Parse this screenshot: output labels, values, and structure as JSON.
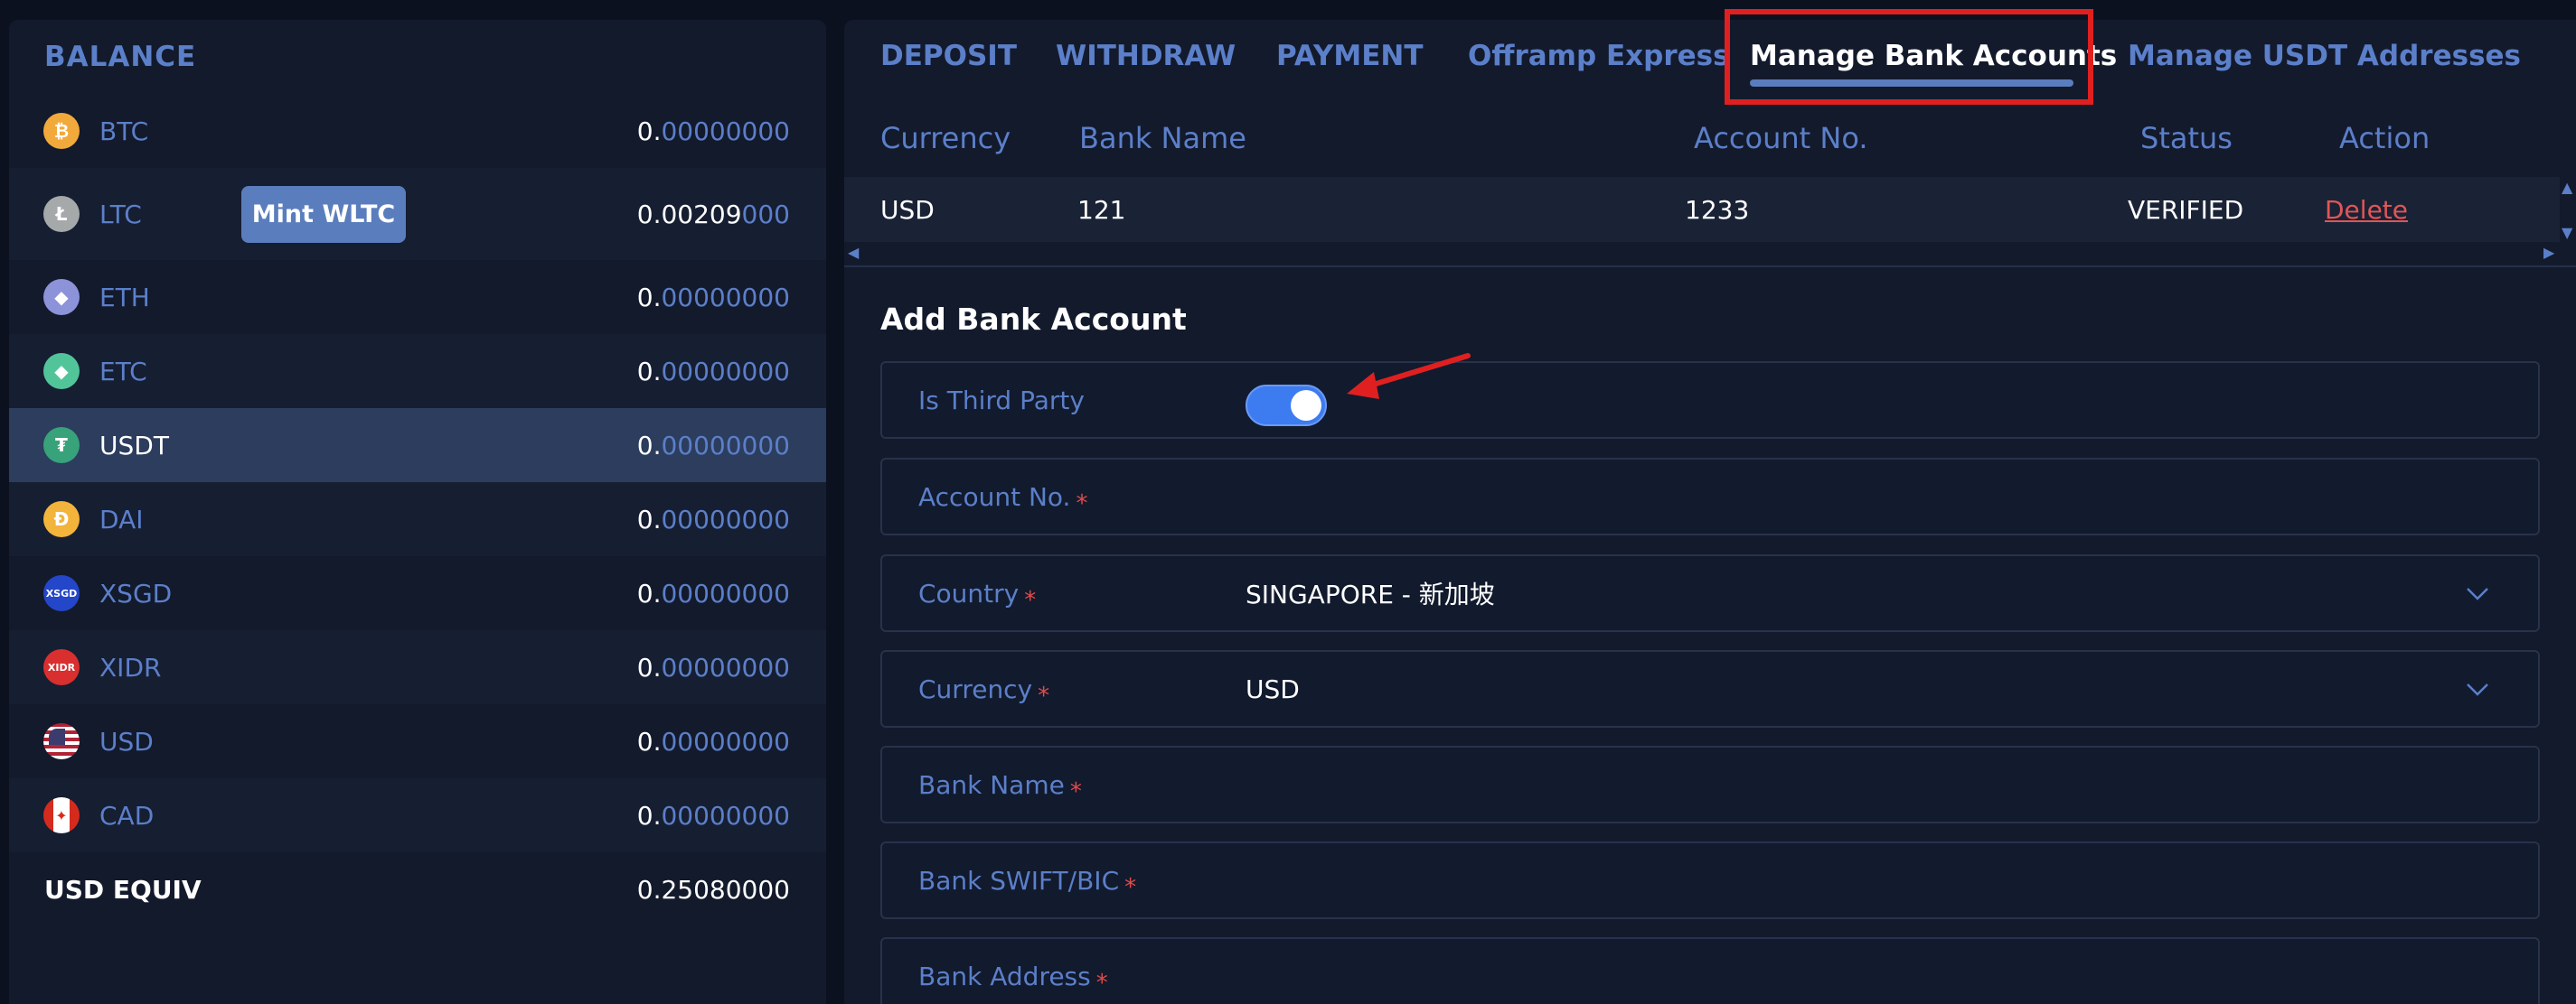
{
  "balance": {
    "title": "BALANCE",
    "assets": [
      {
        "symbol": "BTC",
        "whole": "0.",
        "dec": "00000000",
        "icon": "bitcoin-icon",
        "glyph": "₿",
        "color": "#f2a93b"
      },
      {
        "symbol": "LTC",
        "whole": "0.00209",
        "dec": "000",
        "icon": "litecoin-icon",
        "glyph": "Ł",
        "color": "#a6a9aa",
        "mint_label": "Mint WLTC"
      },
      {
        "symbol": "ETH",
        "whole": "0.",
        "dec": "00000000",
        "icon": "ethereum-icon",
        "glyph": "◆",
        "color": "#8c93d9"
      },
      {
        "symbol": "ETC",
        "whole": "0.",
        "dec": "00000000",
        "icon": "ethereum-classic-icon",
        "glyph": "◆",
        "color": "#52c49a"
      },
      {
        "symbol": "USDT",
        "whole": "0.",
        "dec": "00000000",
        "icon": "tether-icon",
        "glyph": "₮",
        "color": "#38a27a"
      },
      {
        "symbol": "DAI",
        "whole": "0.",
        "dec": "00000000",
        "icon": "dai-icon",
        "glyph": "Ð",
        "color": "#f2b43b"
      },
      {
        "symbol": "XSGD",
        "whole": "0.",
        "dec": "00000000",
        "icon": "xsgd-icon",
        "glyph": "XSGD",
        "color": "#2446c9"
      },
      {
        "symbol": "XIDR",
        "whole": "0.",
        "dec": "00000000",
        "icon": "xidr-icon",
        "glyph": "XIDR",
        "color": "#d92f2f"
      },
      {
        "symbol": "USD",
        "whole": "0.",
        "dec": "00000000",
        "icon": "us-flag-icon",
        "glyph": "",
        "color": "#b22234"
      },
      {
        "symbol": "CAD",
        "whole": "0.",
        "dec": "00000000",
        "icon": "canada-flag-icon",
        "glyph": "",
        "color": "#d52b1e"
      }
    ],
    "equiv_label": "USD EQUIV",
    "equiv_value": "0.25080000"
  },
  "tabs": [
    "DEPOSIT",
    "WITHDRAW",
    "PAYMENT",
    "Offramp Express",
    "Manage Bank Accounts",
    "Manage USDT Addresses"
  ],
  "table": {
    "headers": [
      "Currency",
      "Bank Name",
      "Account No.",
      "Status",
      "Action"
    ],
    "row": {
      "currency": "USD",
      "bank_name": "121",
      "account_no": "1233",
      "status": "VERIFIED",
      "action": "Delete"
    }
  },
  "form": {
    "title": "Add Bank Account",
    "third_party_label": "Is Third Party",
    "account_no_label": "Account No.",
    "country_label": "Country",
    "country_value": "SINGAPORE - 新加坡",
    "currency_label": "Currency",
    "currency_value": "USD",
    "bank_name_label": "Bank Name",
    "swift_label": "Bank SWIFT/BIC",
    "address_label": "Bank Address",
    "required_mark": "*"
  },
  "colors": {
    "accent": "#5b7fc9",
    "highlight": "#e02020",
    "toggle_on": "#3d7bf0"
  }
}
